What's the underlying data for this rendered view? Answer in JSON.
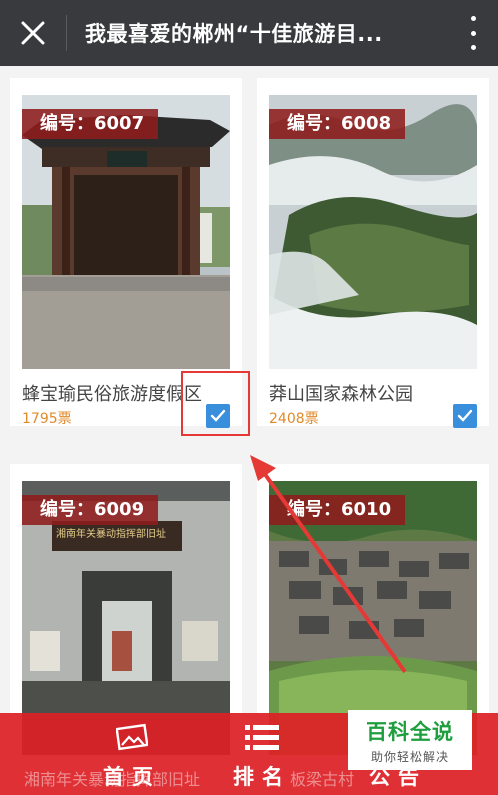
{
  "header": {
    "title": "我最喜爱的郴州“十佳旅游目...",
    "close_icon": "close-icon",
    "more_icon": "more-vertical-icon"
  },
  "cards": [
    {
      "badge": "编号：6007",
      "name": "蜂宝瑜民俗旅游度假区",
      "votes": "1795票",
      "checked": true
    },
    {
      "badge": "编号：6008",
      "name": "莽山国家森林公园",
      "votes": "2408票",
      "checked": true
    },
    {
      "badge": "编号：6009",
      "sign": "湘南年关暴动指挥部旧址",
      "caption": "湘南年关暴动指挥部旧址"
    },
    {
      "badge": "编号：6010",
      "caption": "板梁古村"
    }
  ],
  "bottom_nav": {
    "home": "首页",
    "rank": "排名",
    "notice": "公告"
  },
  "watermark": {
    "title": "百科全说",
    "subtitle": "助你轻松解决"
  },
  "colors": {
    "header_bg": "#393a3e",
    "badge_bg": "#8e1c1c",
    "votes": "#e08a2a",
    "check": "#3a8fdc",
    "bottom_bar": "#dd2026",
    "annotation": "#e53935"
  }
}
